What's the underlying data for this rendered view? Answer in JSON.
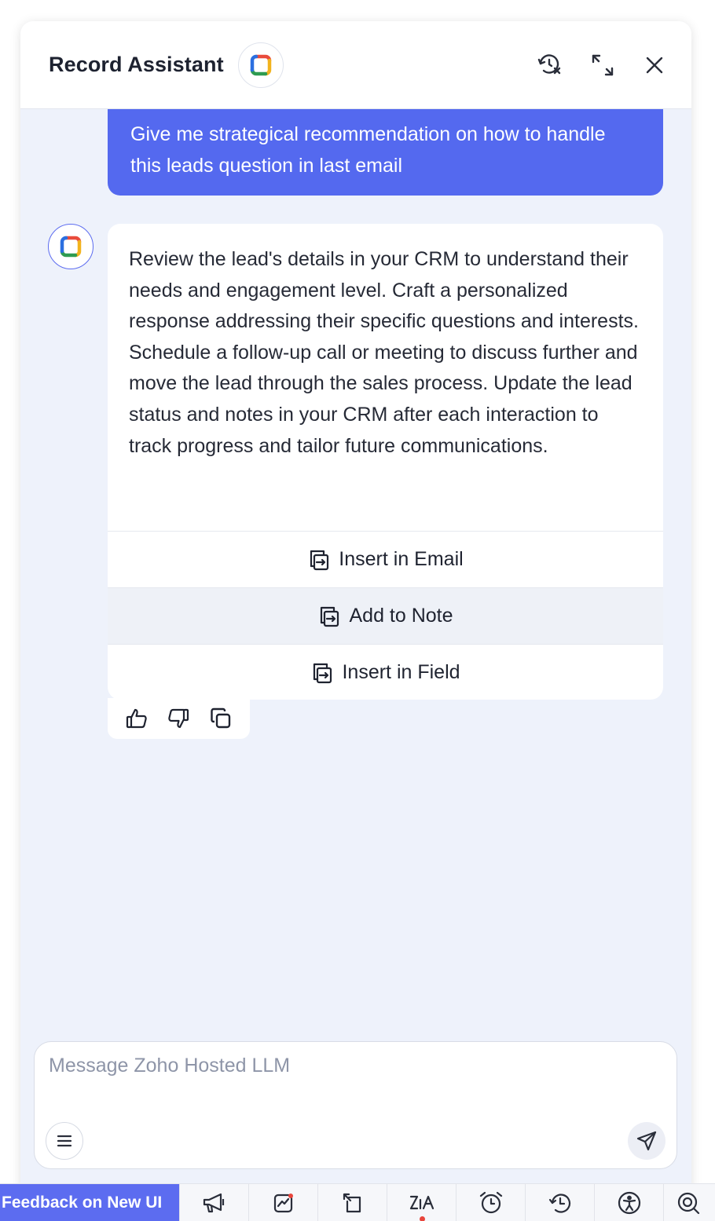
{
  "header": {
    "title": "Record Assistant",
    "logo_icon": "zia-logo-icon",
    "actions": [
      {
        "name": "clear-history-icon"
      },
      {
        "name": "expand-icon"
      },
      {
        "name": "close-icon"
      }
    ]
  },
  "conversation": {
    "user_message": "Give me strategical recommendation on how to handle this leads question in last email",
    "assistant_message": "Review the lead's details in your CRM to understand their needs and engagement level. Craft a personalized response addressing their specific questions and interests. Schedule a follow-up call or meeting to discuss further and move the lead through the sales process. Update the lead status and notes in your CRM after each interaction to track progress and tailor future communications.",
    "actions": [
      {
        "label": "Insert in Email",
        "icon": "insert-icon"
      },
      {
        "label": "Add to Note",
        "icon": "insert-icon",
        "highlighted": true
      },
      {
        "label": "Insert in Field",
        "icon": "insert-icon"
      }
    ],
    "feedback": [
      "thumbs-up-icon",
      "thumbs-down-icon",
      "copy-icon"
    ]
  },
  "composer": {
    "placeholder": "Message Zoho Hosted LLM",
    "value": ""
  },
  "taskbar": {
    "feedback_label": "Feedback on New UI",
    "items": [
      "megaphone-icon",
      "analytics-icon",
      "signals-icon",
      "zia-icon",
      "alarm-icon",
      "history-icon",
      "accessibility-icon",
      "search-icon"
    ]
  },
  "colors": {
    "accent": "#5469ef",
    "panel_bg": "#eef2fb",
    "notification_dot": "#e8453c"
  }
}
